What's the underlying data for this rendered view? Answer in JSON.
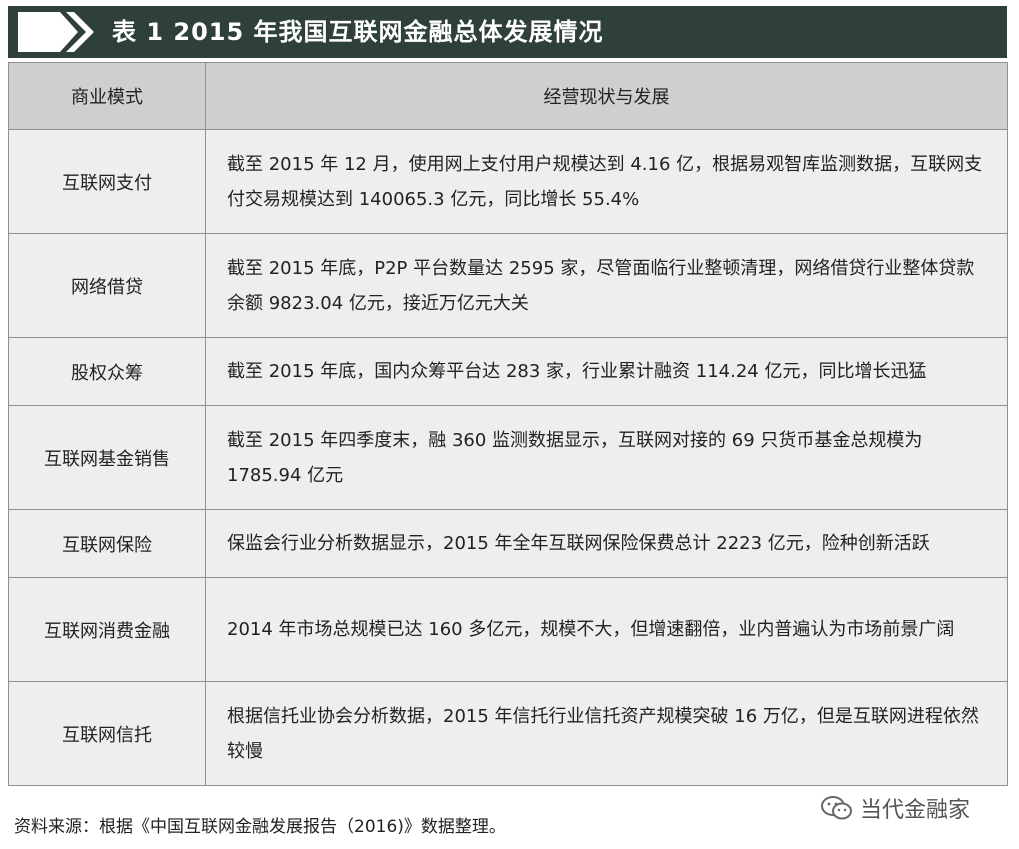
{
  "title": "表 1  2015 年我国互联网金融总体发展情况",
  "header": {
    "col1": "商业模式",
    "col2": "经营现状与发展"
  },
  "rows": [
    {
      "model": "互联网支付",
      "desc": "截至 2015 年 12 月，使用网上支付用户规模达到 4.16 亿，根据易观智库监测数据，互联网支付交易规模达到 140065.3 亿元，同比增长 55.4%"
    },
    {
      "model": "网络借贷",
      "desc": "截至 2015 年底，P2P 平台数量达 2595 家，尽管面临行业整顿清理，网络借贷行业整体贷款余额 9823.04 亿元，接近万亿元大关"
    },
    {
      "model": "股权众筹",
      "desc": "截至 2015 年底，国内众筹平台达 283 家，行业累计融资 114.24 亿元，同比增长迅猛"
    },
    {
      "model": "互联网基金销售",
      "desc": "截至 2015 年四季度末，融 360 监测数据显示，互联网对接的 69 只货币基金总规模为 1785.94 亿元"
    },
    {
      "model": "互联网保险",
      "desc": "保监会行业分析数据显示，2015 年全年互联网保险保费总计 2223 亿元，险种创新活跃"
    },
    {
      "model": "互联网消费金融",
      "desc": "2014 年市场总规模已达 160 多亿元，规模不大，但增速翻倍，业内普遍认为市场前景广阔"
    },
    {
      "model": "互联网信托",
      "desc": "根据信托业协会分析数据，2015 年信托行业信托资产规模突破 16 万亿，但是互联网进程依然较慢"
    }
  ],
  "source": "资料来源：根据《中国互联网金融发展报告（2016)》数据整理。",
  "watermark": "当代金融家",
  "colors": {
    "title_bg": "#2f3f3c",
    "header_bg": "#cfcfcf",
    "row_bg": "#eeeeee",
    "border": "#8f8f8f"
  }
}
